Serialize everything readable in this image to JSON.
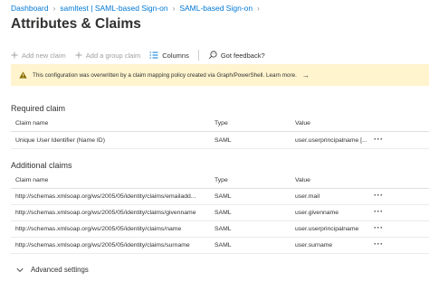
{
  "breadcrumb": {
    "items": [
      "Dashboard",
      "samltest | SAML-based Sign-on",
      "SAML-based Sign-on"
    ],
    "separator": "›"
  },
  "page": {
    "title": "Attributes & Claims",
    "more": "···"
  },
  "toolbar": {
    "add_new_claim": "Add new claim",
    "add_group_claim": "Add a group claim",
    "columns": "Columns",
    "feedback": "Got feedback?"
  },
  "banner": {
    "message": "This configuration was overwritten by a claim mapping policy created via Graph/PowerShell. Learn more.",
    "arrow": "→",
    "color": "#fff4ce"
  },
  "required": {
    "title": "Required claim",
    "headers": {
      "name": "Claim name",
      "type": "Type",
      "value": "Value"
    },
    "rows": [
      {
        "name": "Unique User Identifier (Name ID)",
        "type": "SAML",
        "value": "user.userprincipalname [..."
      }
    ]
  },
  "additional": {
    "title": "Additional claims",
    "headers": {
      "name": "Claim name",
      "type": "Type",
      "value": "Value"
    },
    "rows": [
      {
        "name": "http://schemas.xmlsoap.org/ws/2005/05/identity/claims/emailadd...",
        "type": "SAML",
        "value": "user.mail"
      },
      {
        "name": "http://schemas.xmlsoap.org/ws/2005/05/identity/claims/givenname",
        "type": "SAML",
        "value": "user.givenname"
      },
      {
        "name": "http://schemas.xmlsoap.org/ws/2005/05/identity/claims/name",
        "type": "SAML",
        "value": "user.userprincipalname"
      },
      {
        "name": "http://schemas.xmlsoap.org/ws/2005/05/identity/claims/surname",
        "type": "SAML",
        "value": "user.surname"
      }
    ]
  },
  "row_more": "···",
  "advanced": {
    "label": "Advanced settings"
  },
  "colors": {
    "link": "#0078d4",
    "text": "#323130",
    "disabled": "#a19f9d",
    "warning_icon": "#8a6d00"
  }
}
